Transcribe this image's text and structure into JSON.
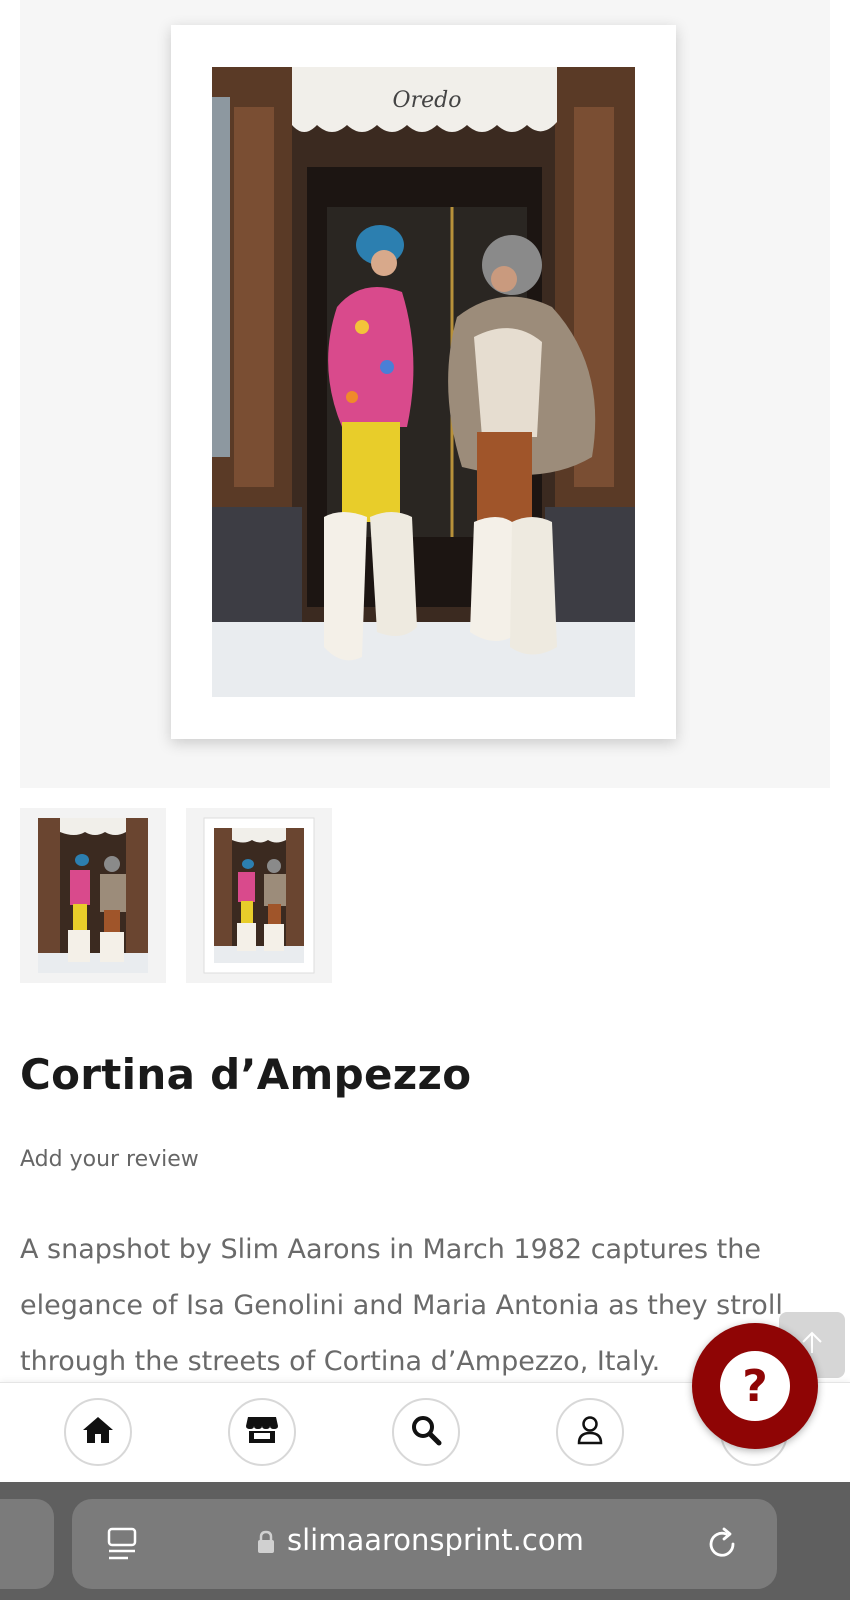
{
  "product": {
    "title": "Cortina d’Ampezzo",
    "review_link": "Add your review",
    "description": "A snapshot by Slim Aarons in March 1982 captures the elegance of Isa Genolini and Maria Antonia as they stroll through the streets of Cortina d’Ampezzo, Italy.",
    "awning_sign": "Oredo"
  },
  "gallery": {
    "thumbnails": [
      {
        "name": "photo-only",
        "selected": true
      },
      {
        "name": "framed-print",
        "selected": false
      }
    ]
  },
  "bottom_nav": {
    "items": [
      {
        "icon": "home-icon"
      },
      {
        "icon": "store-icon"
      },
      {
        "icon": "search-icon"
      },
      {
        "icon": "account-icon"
      }
    ]
  },
  "help_button": {
    "label": "?"
  },
  "browser": {
    "url": "slimaaronsprint.com"
  },
  "colors": {
    "help_red": "#8f0505",
    "browser_bar": "#5f5f5f",
    "text_dark": "#1a1a1a",
    "text_muted": "#6a6a6a"
  }
}
